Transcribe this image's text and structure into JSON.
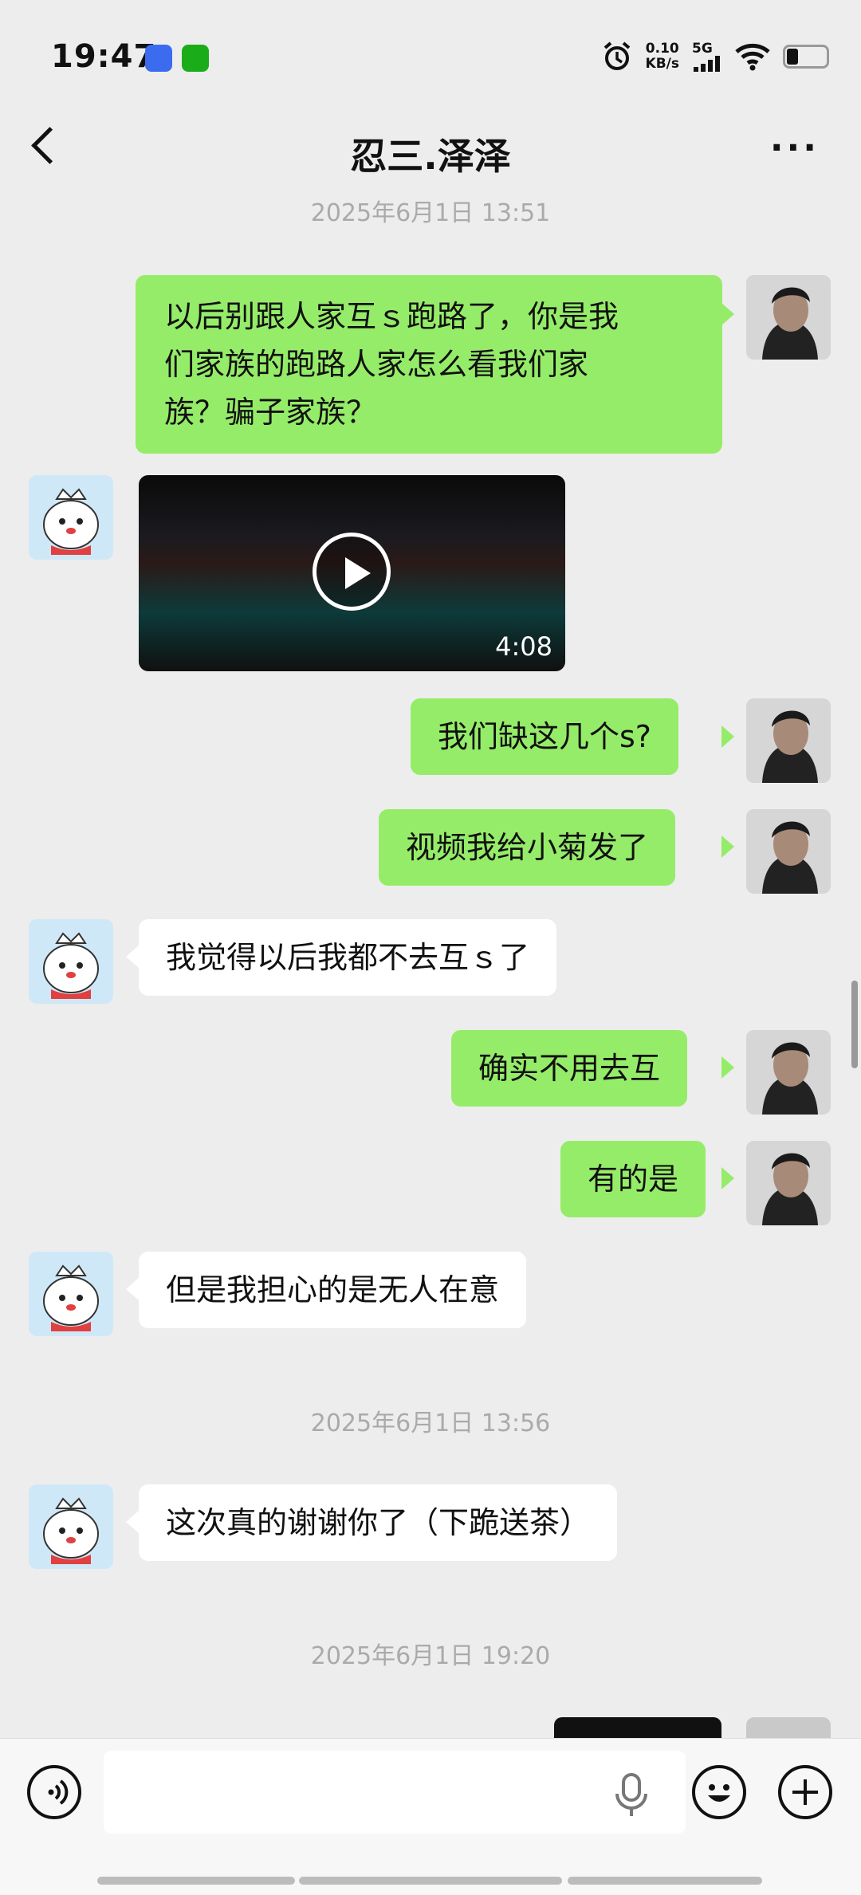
{
  "status_bar": {
    "time": "19:47",
    "speed_value": "0.10",
    "speed_unit": "KB/s",
    "network": "5G",
    "icons": [
      "video-app-icon",
      "wechat-icon",
      "alarm-icon",
      "signal-icon",
      "wifi-icon",
      "battery-icon"
    ]
  },
  "header": {
    "title": "忍三.泽泽",
    "back_icon": "back-arrow-icon",
    "more_icon": "more-icon"
  },
  "timestamps": [
    "2025年6月1日 13:51",
    "2025年6月1日 13:56",
    "2025年6月1日 19:20"
  ],
  "messages": [
    {
      "sender": "me",
      "lines": [
        "以后别跟人家互ｓ跑路了，你是我",
        "们家族的跑路人家怎么看我们家",
        "族？骗子家族？"
      ]
    },
    {
      "sender": "other",
      "type": "video",
      "duration": "4:08"
    },
    {
      "sender": "me",
      "text": "我们缺这几个s?"
    },
    {
      "sender": "me",
      "text": "视频我给小菊发了"
    },
    {
      "sender": "other",
      "text": "我觉得以后我都不去互ｓ了"
    },
    {
      "sender": "me",
      "text": "确实不用去互"
    },
    {
      "sender": "me",
      "text": "有的是"
    },
    {
      "sender": "other",
      "text": "但是我担心的是无人在意"
    },
    {
      "sender": "other",
      "text": "这次真的谢谢你了（下跪送茶）"
    }
  ],
  "input_bar": {
    "icons": [
      "voice-icon",
      "microphone-icon",
      "emoji-icon",
      "plus-icon"
    ]
  },
  "colors": {
    "background": "#ededed",
    "my_bubble": "#95ec69",
    "their_bubble": "#ffffff",
    "timestamp": "#aaaaaa"
  }
}
